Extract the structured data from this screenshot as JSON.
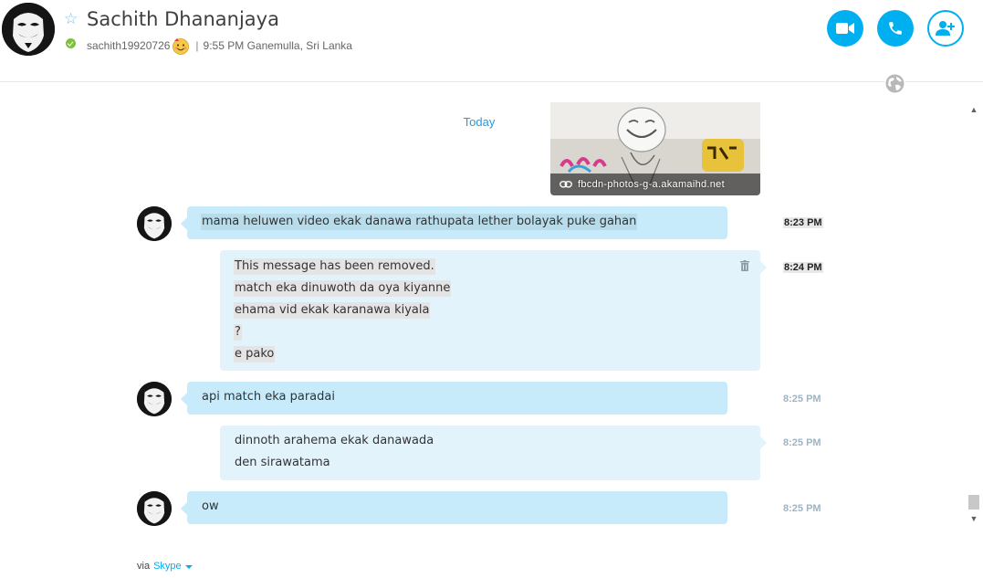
{
  "header": {
    "contact_name": "Sachith Dhananjaya",
    "username": "sachith19920726",
    "separator": "|",
    "local_time_location": "9:55 PM Ganemulla, Sri Lanka",
    "status": "online",
    "status_color": "#7ec13f",
    "accent_color": "#00aff0",
    "buttons": {
      "video_icon": "video-camera-icon",
      "call_icon": "phone-icon",
      "add_icon": "add-person-icon"
    }
  },
  "conversation": {
    "day_separator": "Today",
    "image_preview": {
      "caption": "fbcdn-photos-g-a.akamaihd.net"
    },
    "messages": [
      {
        "direction": "incoming",
        "lines": [
          "mama heluwen video ekak danawa rathupata lether bolayak puke gahan"
        ],
        "time": "8:23 PM"
      },
      {
        "direction": "outgoing",
        "lines": [
          "This message has been removed.",
          "match eka dinuwoth da oya kiyanne",
          "ehama vid ekak karanawa kiyala",
          "?",
          "e pako"
        ],
        "time": "8:24 PM"
      },
      {
        "direction": "incoming",
        "lines": [
          "api match eka paradai"
        ],
        "time": "8:25 PM"
      },
      {
        "direction": "outgoing",
        "lines": [
          "dinnoth arahema ekak danawada",
          "den sirawatama"
        ],
        "time": "8:25 PM"
      },
      {
        "direction": "incoming",
        "lines": [
          "ow"
        ],
        "time": "8:25 PM"
      }
    ]
  },
  "footer": {
    "via_label": "via",
    "service_label": "Skype"
  }
}
